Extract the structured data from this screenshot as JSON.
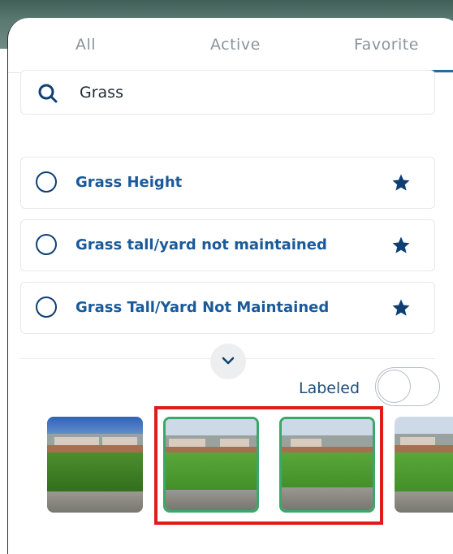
{
  "tabs": [
    {
      "label": "All"
    },
    {
      "label": "Active"
    },
    {
      "label": "Favorite"
    }
  ],
  "active_tab": "Favorite",
  "search": {
    "value": "Grass",
    "icon": "search-icon"
  },
  "items": [
    {
      "label": "Grass Height",
      "favorited": true
    },
    {
      "label": "Grass tall/yard not maintained",
      "favorited": true
    },
    {
      "label": "Grass Tall/Yard Not Maintained",
      "favorited": true
    }
  ],
  "expand_icon": "chevron-down-icon",
  "labeled_toggle": {
    "label": "Labeled",
    "on": false
  },
  "photos": [
    {
      "selected": false
    },
    {
      "selected": true
    },
    {
      "selected": true
    },
    {
      "selected": false
    }
  ],
  "colors": {
    "accent": "#2a6a9a",
    "item_text": "#1a5a9a",
    "radio": "#0e3f73",
    "star": "#0e3f73",
    "selection_border": "#3aa86a",
    "highlight_box": "#e01b1b"
  }
}
